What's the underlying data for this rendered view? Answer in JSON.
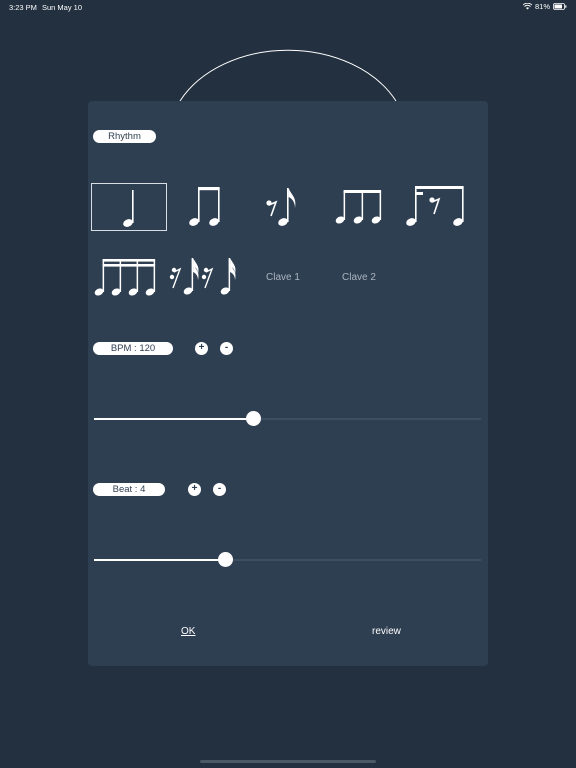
{
  "status_bar": {
    "time": "3:23 PM",
    "date": "Sun May 10",
    "battery": "81%"
  },
  "rhythm": {
    "label": "Rhythm",
    "options": [
      {
        "name": "quarter-note",
        "selected": true
      },
      {
        "name": "two-eighth-notes",
        "selected": false
      },
      {
        "name": "eighth-rest-eighth-note",
        "selected": false
      },
      {
        "name": "triplet-eighth-notes",
        "selected": false
      },
      {
        "name": "eighth-sixteenth-rest-pattern",
        "selected": false
      },
      {
        "name": "four-sixteenth-notes",
        "selected": false
      },
      {
        "name": "sixteenth-rest-patterns",
        "selected": false
      }
    ],
    "clave1": "Clave 1",
    "clave2": "Clave 2"
  },
  "bpm": {
    "label": "BPM  :  120",
    "plus": "+",
    "minus": "-",
    "value": 120,
    "fill_fraction": 0.42
  },
  "beat": {
    "label": "Beat  :  4",
    "plus": "+",
    "minus": "-",
    "value": 4,
    "fill_fraction": 0.34
  },
  "footer": {
    "ok": "OK",
    "review": "review"
  }
}
